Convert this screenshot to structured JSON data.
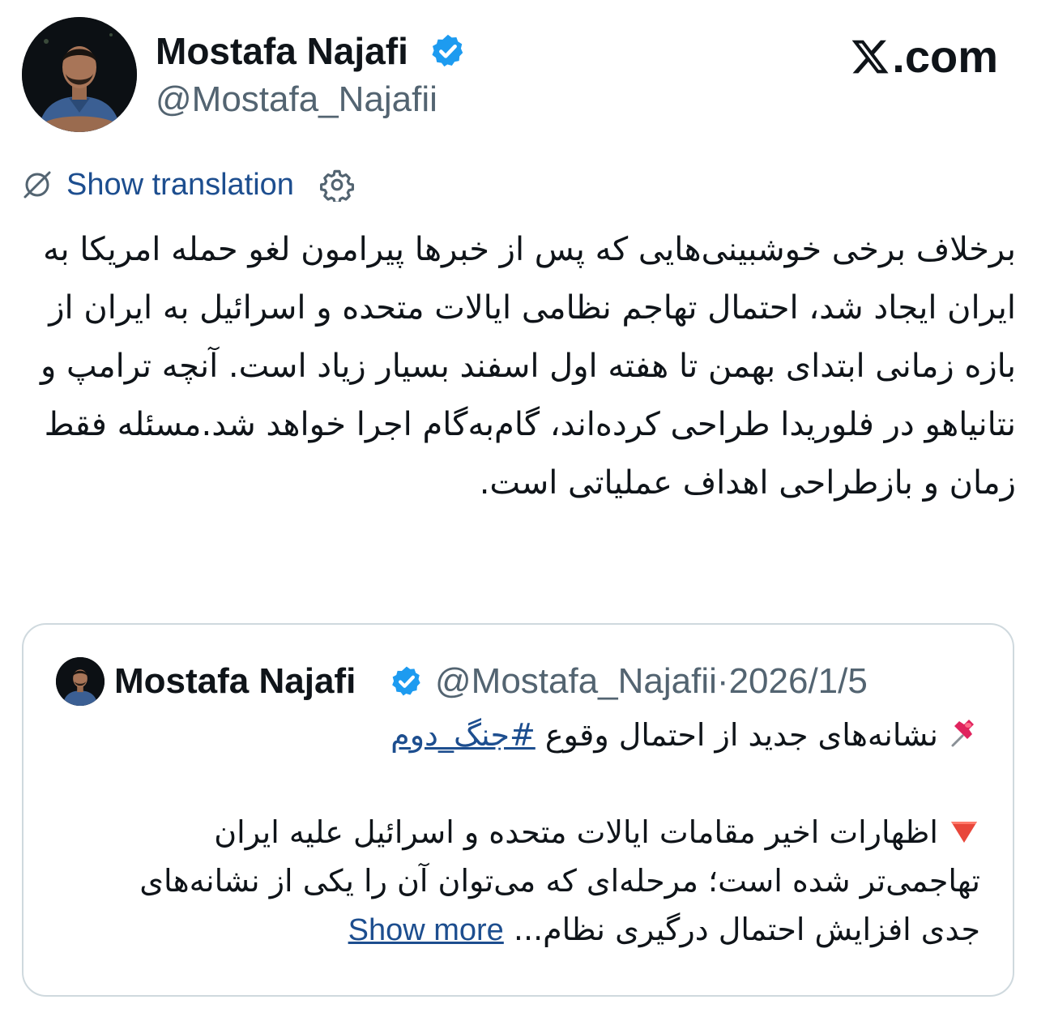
{
  "author": {
    "display_name": "Mostafa Najafi",
    "handle": "@Mostafa_Najafii",
    "verified": true
  },
  "site": {
    "domain": ".com",
    "logo_icon": "x-logo-icon"
  },
  "translation": {
    "label": "Show translation",
    "icon": "translate-off-icon",
    "settings_icon": "gear-icon"
  },
  "tweet": {
    "text": "برخلاف برخی خوشبینی‌هایی که پس از خبرها پیرامون لغو حمله امریکا به ایران ایجاد شد، احتمال تهاجم نظامی ایالات متحده و اسرائیل به ایران از بازه زمانی ابتدای بهمن تا هفته اول اسفند بسیار زیاد است. آنچه ترامپ و نتانیاهو در فلوریدا طراحی کرده‌اند، گام‌به‌گام اجرا خواهد شد.مسئله فقط زمان و بازطراحی اهداف عملیاتی است."
  },
  "quote": {
    "display_name": "Mostafa Najafi",
    "handle": "@Mostafa_Najafii",
    "separator": "·",
    "date": "2026/1/5",
    "line1_emoji": "pushpin-emoji",
    "line1_text": "نشانه‌های جدید از احتمال وقوع ",
    "hashtag": "#جنگ_دوم",
    "line2_emoji": "red-triangle-down-emoji",
    "line2_text": "اظهارات اخیر مقامات ایالات متحده و اسرائیل علیه ایران تهاجمی‌تر شده است؛ مرحله‌ای که می‌توان آن را یکی از نشانه‌های جدی افزایش احتمال درگیری نظام",
    "ellipsis": "...",
    "show_more": "Show more"
  },
  "colors": {
    "text_primary": "#0f1419",
    "text_secondary": "#536471",
    "link": "#1d4e8f",
    "verified": "#1d9bf0",
    "border": "#cfd9de"
  }
}
